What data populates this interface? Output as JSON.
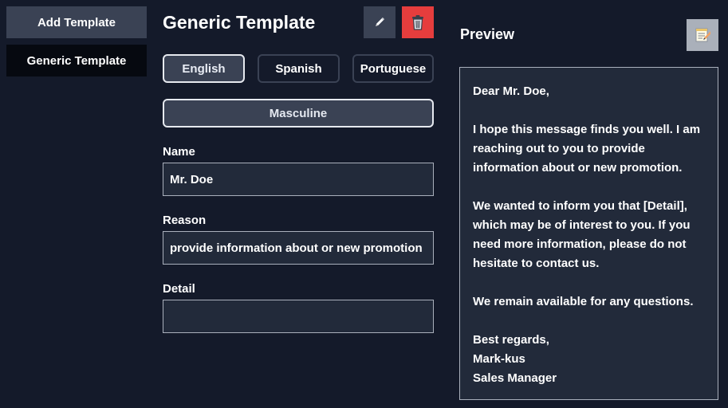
{
  "sidebar": {
    "add_label": "Add Template",
    "templates": [
      "Generic Template"
    ]
  },
  "template": {
    "title": "Generic Template"
  },
  "languages": [
    "English",
    "Spanish",
    "Portuguese"
  ],
  "selected_language": "English",
  "gender": "Masculine",
  "fields": {
    "name": {
      "label": "Name",
      "value": "Mr. Doe"
    },
    "reason": {
      "label": "Reason",
      "value": "provide information about or new promotion"
    },
    "detail": {
      "label": "Detail",
      "value": ""
    }
  },
  "preview": {
    "title": "Preview",
    "greeting": "Dear Mr. Doe,",
    "para1": "I hope this message finds you well. I am reaching out to you to provide information about or new promotion.",
    "para2": "We wanted to inform you that [Detail], which may be of interest to you. If you need more information, please do not hesitate to contact us.",
    "para3": "We remain available for any questions.",
    "closing": "Best regards,",
    "signer": "Mark-kus",
    "signer_title": "Sales Manager"
  },
  "colors": {
    "background": "#141a2a",
    "panel": "#222a3a",
    "button": "#3a4254",
    "danger": "#e63d3d"
  },
  "icons": {
    "edit": "pencil-icon",
    "delete": "trash-icon",
    "copy": "memo-icon"
  }
}
